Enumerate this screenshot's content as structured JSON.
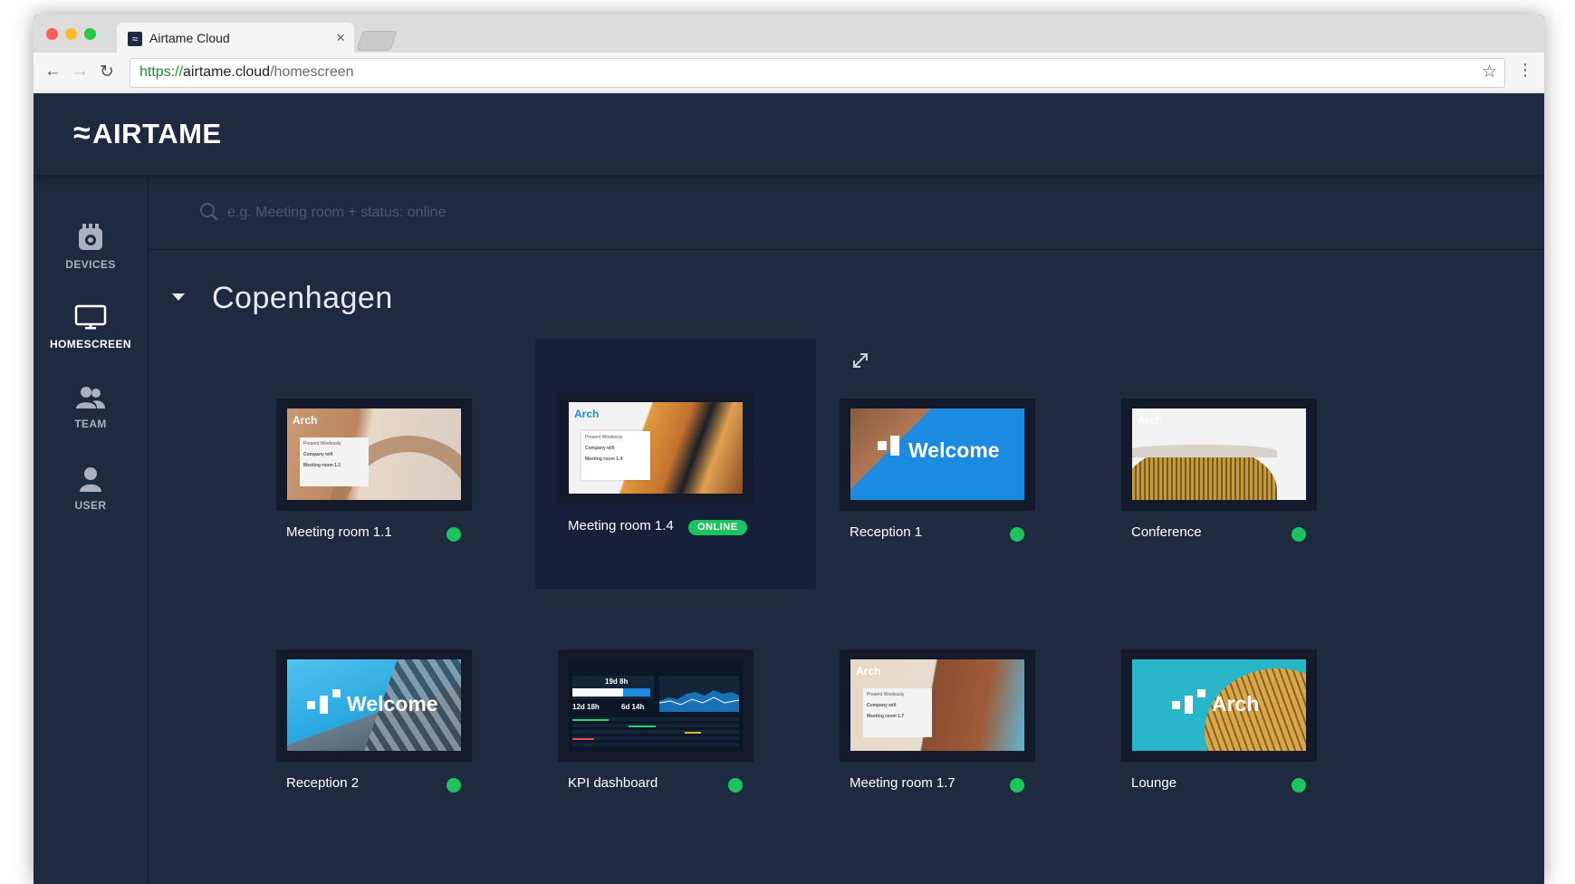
{
  "browser": {
    "tab_title": "Airtame Cloud",
    "url_scheme": "https://",
    "url_host": "airtame.cloud",
    "url_path": "/homescreen"
  },
  "app": {
    "logo_text": "AIRTAME",
    "logo_mark": "≈"
  },
  "sidebar": {
    "items": [
      {
        "label": "DEVICES",
        "icon": "devices-icon",
        "active": false
      },
      {
        "label": "HOMESCREEN",
        "icon": "monitor-icon",
        "active": true
      },
      {
        "label": "TEAM",
        "icon": "team-icon",
        "active": false
      },
      {
        "label": "USER",
        "icon": "user-icon",
        "active": false
      }
    ]
  },
  "search": {
    "placeholder": "e.g. Meeting room + status: online"
  },
  "group": {
    "title": "Copenhagen"
  },
  "devices": [
    {
      "name": "Meeting room 1.1",
      "status": "online",
      "screen": "arch-info",
      "room": "Meeting room 1.1"
    },
    {
      "name": "Meeting room 1.4",
      "status": "online",
      "badge": "ONLINE",
      "screen": "arch-info",
      "room": "Meeting room 1.4"
    },
    {
      "name": "Reception 1",
      "status": "online",
      "screen": "welcome",
      "overlay": "Welcome"
    },
    {
      "name": "Conference",
      "status": "online",
      "screen": "arch-plain",
      "overlay": "Arch"
    },
    {
      "name": "Reception 2",
      "status": "online",
      "screen": "welcome",
      "overlay": "Welcome"
    },
    {
      "name": "KPI dashboard",
      "status": "online",
      "screen": "kpi"
    },
    {
      "name": "Meeting room 1.7",
      "status": "online",
      "screen": "arch-info",
      "room": "Meeting room 1.7"
    },
    {
      "name": "Lounge",
      "status": "online",
      "screen": "arch-big",
      "overlay": "Arch"
    }
  ],
  "screen_text": {
    "brand": "Arch",
    "present": "Present Wirelessly",
    "connect_label": "Connect to",
    "wifi": "Company wifi",
    "choose_label": "Choose",
    "kpi_values": [
      "19d 8h",
      "12d 18h",
      "6d 14h"
    ]
  },
  "colors": {
    "app_bg": "#1e2a40",
    "highlight": "#16203a",
    "status_online": "#1dc35f",
    "welcome_blue": "#1a8be0",
    "lounge_teal": "#28b6c8"
  }
}
